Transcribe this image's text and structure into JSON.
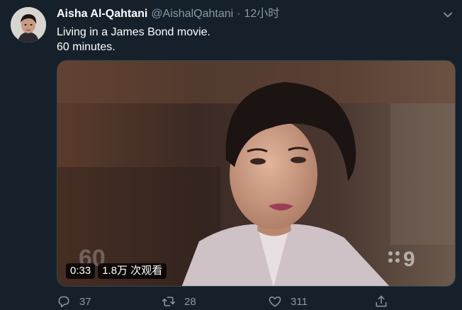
{
  "tweet": {
    "author": {
      "display_name": "Aisha Al-Qahtani",
      "handle": "@AishalQahtani",
      "separator": "·",
      "time": "12小时"
    },
    "text_lines": [
      "Living in a James Bond movie.",
      "60 minutes."
    ],
    "media": {
      "duration": "0:33",
      "views": "1.8万 次观看"
    },
    "actions": {
      "reply_count": "37",
      "retweet_count": "28",
      "like_count": "311"
    }
  },
  "icons": {
    "reply": "reply-icon",
    "retweet": "retweet-icon",
    "like": "heart-icon",
    "share": "share-icon",
    "more": "chevron-down-icon"
  },
  "colors": {
    "background": "#15202b",
    "secondary_text": "#8899a6",
    "border": "#38444d"
  }
}
